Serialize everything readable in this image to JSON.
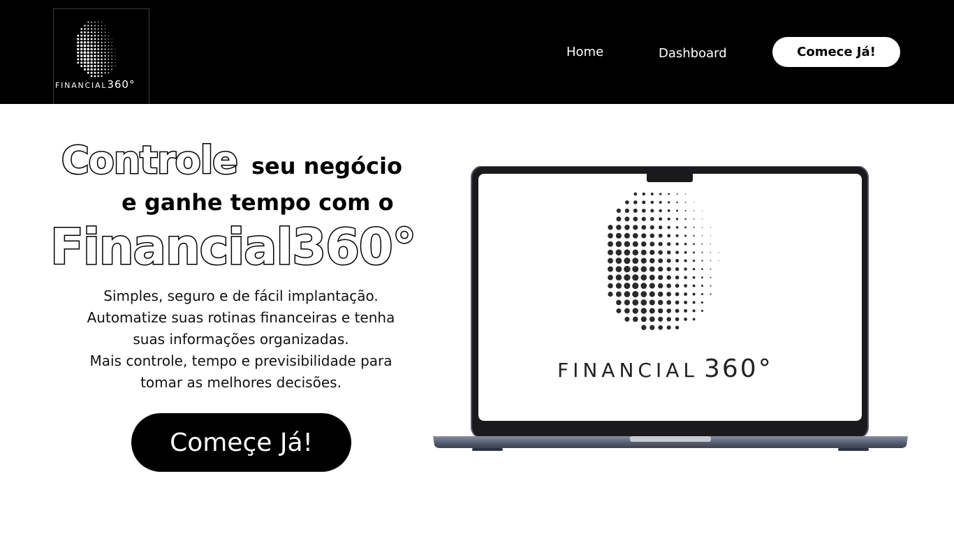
{
  "header": {
    "logo": {
      "text": "FINANCIAL",
      "text_suffix": "360°",
      "icon": "dotted-globe-icon"
    },
    "nav": [
      {
        "label": "Home"
      },
      {
        "label": "Dashboard"
      }
    ],
    "cta_label": "Comece Já!"
  },
  "hero": {
    "headline_outline_word": "Controle",
    "headline_rest_1": "seu negócio",
    "headline_line_2": "e ganhe tempo com o",
    "brand_name": "Financial360°",
    "description_lines": [
      "Simples, seguro e de fácil implantação.",
      "Automatize suas rotinas financeiras e tenha",
      "suas informações organizadas.",
      "Mais controle, tempo e previsibilidade para",
      "tomar as melhores decisões."
    ],
    "cta_label": "Começe Já!"
  },
  "laptop_screen": {
    "logo_text": "FINANCIAL",
    "logo_suffix": "360°",
    "icon": "dotted-globe-icon"
  },
  "colors": {
    "header_bg": "#000000",
    "page_bg": "#ffffff",
    "laptop_body": "#5b6275"
  }
}
